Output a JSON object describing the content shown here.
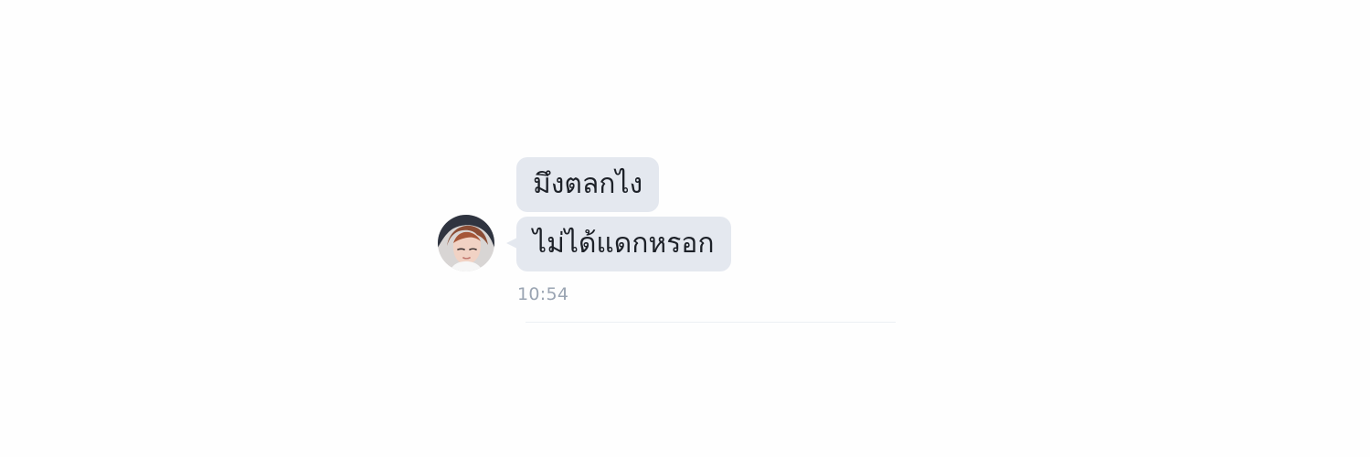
{
  "conversation": {
    "messages": [
      {
        "sender": "incoming",
        "text": "มึงตลกไง"
      },
      {
        "sender": "incoming",
        "text": "ไม่ได้แดกหรอก"
      }
    ],
    "timestamp": "10:54"
  },
  "colors": {
    "bubble_background": "#e4e8ef",
    "text": "#1d2128",
    "timestamp": "#9aa4b2",
    "page_background": "#fefefe",
    "divider": "#eceff3"
  },
  "icons": {
    "avatar": "contact-avatar"
  }
}
